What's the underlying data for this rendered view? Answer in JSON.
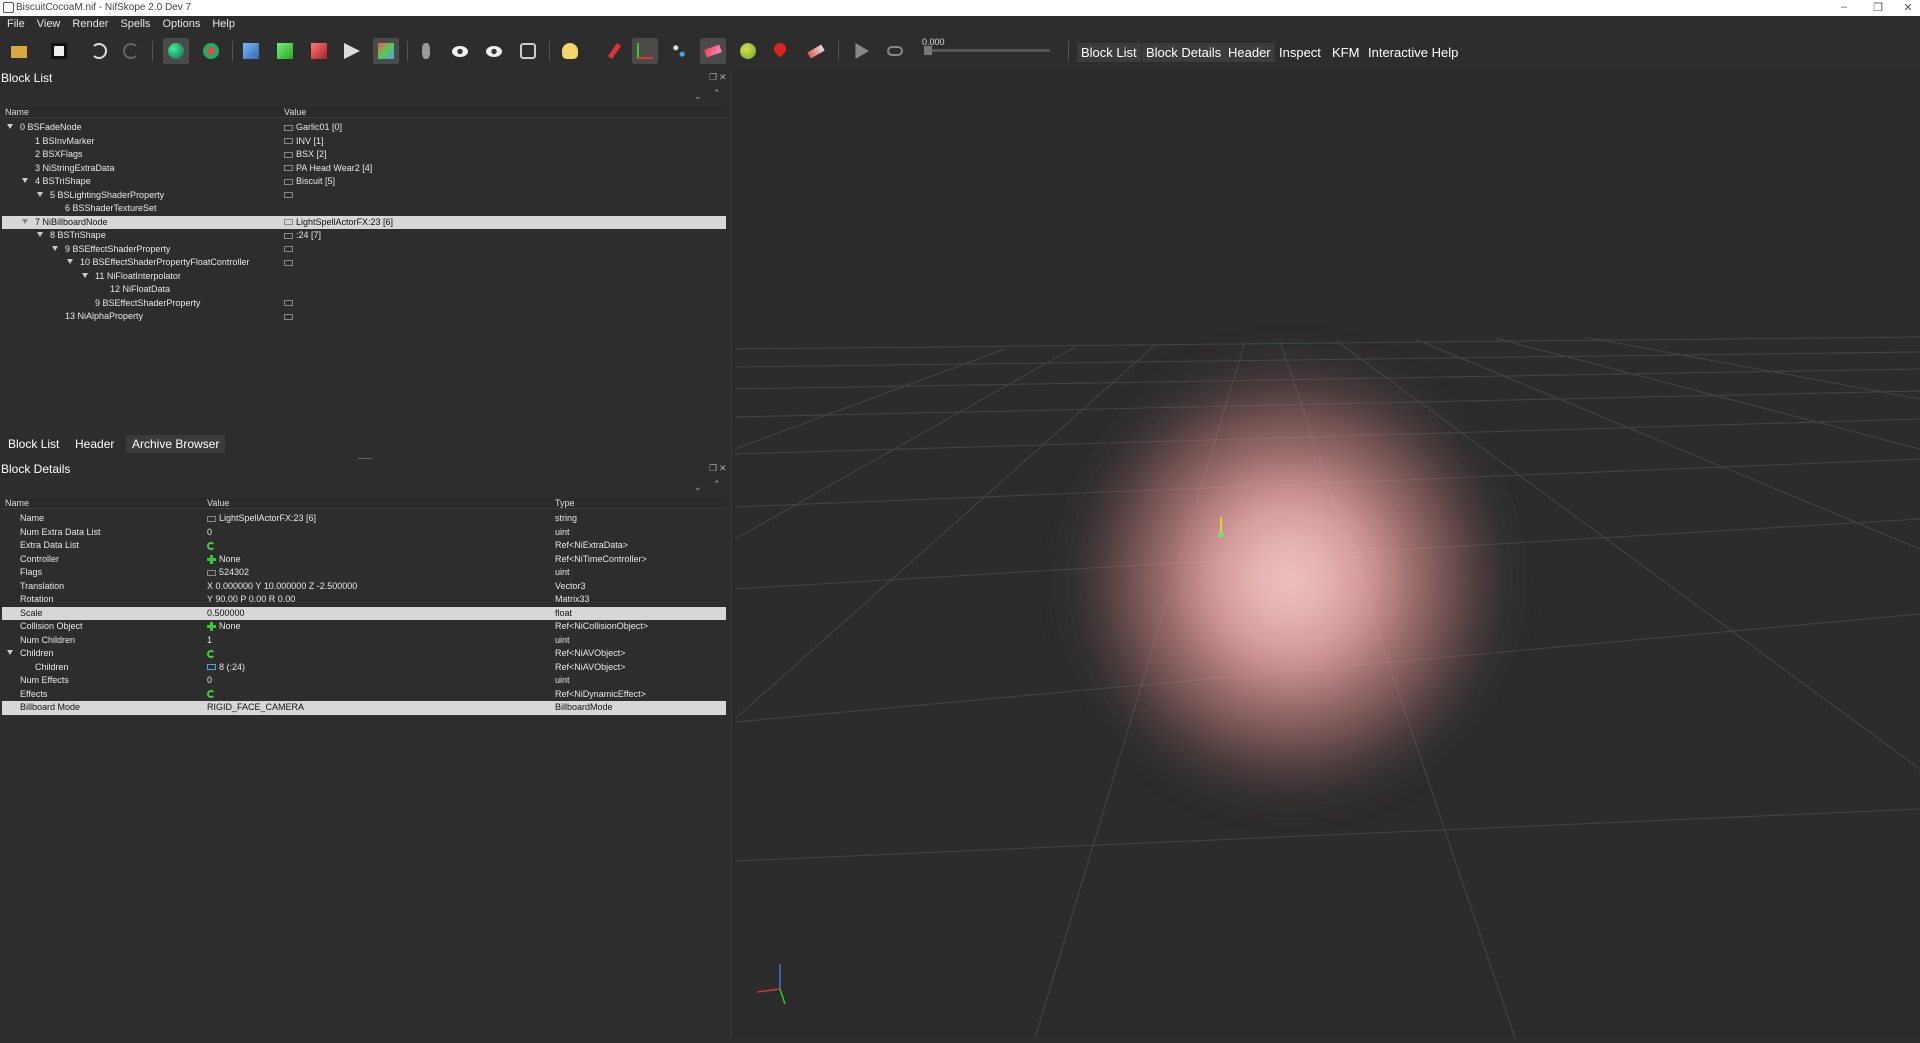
{
  "window": {
    "title": "BiscuitCocoaM.nif - NifSkope 2.0 Dev 7",
    "controls": [
      "–",
      "❐",
      "✕"
    ]
  },
  "menu": [
    "File",
    "View",
    "Render",
    "Spells",
    "Options",
    "Help"
  ],
  "toolbar": {
    "icons": [
      "load-icon",
      "save-icon",
      "undo-icon",
      "redo-icon",
      "select-icon",
      "transform-icon",
      "view-front-icon",
      "view-top-icon",
      "view-side-icon",
      "view-user-icon",
      "view-walk-icon",
      "footprints-icon",
      "eye-icon",
      "eye-show-icon",
      "screenshot-icon",
      "light-icon",
      "pin-icon",
      "axes-icon",
      "nodes-icon",
      "wand-icon",
      "sphere-icon",
      "marker-icon",
      "brush-icon",
      "play-icon",
      "loop-icon"
    ],
    "time_value": "0.000",
    "tabs": [
      "Block List",
      "Block Details",
      "Header",
      "Inspect",
      "KFM",
      "Interactive Help"
    ]
  },
  "block_list": {
    "title": "Block List",
    "columns": [
      "Name",
      "Value"
    ],
    "rows": [
      {
        "name": "0 BSFadeNode",
        "value": "Garlic01 [0]"
      },
      {
        "name": "1 BSInvMarker",
        "value": "INV [1]"
      },
      {
        "name": "2 BSXFlags",
        "value": "BSX [2]"
      },
      {
        "name": "3 NiStringExtraData",
        "value": "PA Head Wear2 [4]"
      },
      {
        "name": "4 BSTriShape",
        "value": "Biscuit [5]"
      },
      {
        "name": "5 BSLightingShaderProperty",
        "value": ""
      },
      {
        "name": "6 BSShaderTextureSet",
        "value": ""
      },
      {
        "name": "7 NiBillboardNode",
        "value": "LightSpellActorFX:23 [6]"
      },
      {
        "name": "8 BSTriShape",
        "value": ":24 [7]"
      },
      {
        "name": "9 BSEffectShaderProperty",
        "value": ""
      },
      {
        "name": "10 BSEffectShaderPropertyFloatController",
        "value": ""
      },
      {
        "name": "11 NiFloatInterpolator",
        "value": ""
      },
      {
        "name": "12 NiFloatData",
        "value": ""
      },
      {
        "name": "9 BSEffectShaderProperty",
        "value": ""
      },
      {
        "name": "13 NiAlphaProperty",
        "value": ""
      }
    ],
    "bottom_tabs": [
      "Block List",
      "Header",
      "Archive Browser"
    ]
  },
  "block_details": {
    "title": "Block Details",
    "columns": [
      "Name",
      "Value",
      "Type"
    ],
    "rows": [
      {
        "name": "Name",
        "value": "LightSpellActorFX:23 [6]",
        "type": "string"
      },
      {
        "name": "Num Extra Data List",
        "value": "0",
        "type": "uint"
      },
      {
        "name": "Extra Data List",
        "value": "",
        "type": "Ref<NiExtraData>"
      },
      {
        "name": "Controller",
        "value": "None",
        "type": "Ref<NiTimeController>"
      },
      {
        "name": "Flags",
        "value": "524302",
        "type": "uint"
      },
      {
        "name": "Translation",
        "value": "X 0.000000 Y 10.000000 Z -2.500000",
        "type": "Vector3"
      },
      {
        "name": "Rotation",
        "value": "Y 90.00 P 0.00 R 0.00",
        "type": "Matrix33"
      },
      {
        "name": "Scale",
        "value": "0.500000",
        "type": "float"
      },
      {
        "name": "Collision Object",
        "value": "None",
        "type": "Ref<NiCollisionObject>"
      },
      {
        "name": "Num Children",
        "value": "1",
        "type": "uint"
      },
      {
        "name": "Children",
        "value": "",
        "type": "Ref<NiAVObject>"
      },
      {
        "name": "Children",
        "value": "8 (:24)",
        "type": "Ref<NiAVObject>"
      },
      {
        "name": "Num Effects",
        "value": "0",
        "type": "uint"
      },
      {
        "name": "Effects",
        "value": "",
        "type": "Ref<NiDynamicEffect>"
      },
      {
        "name": "Billboard Mode",
        "value": "RIGID_FACE_CAMERA",
        "type": "BillboardMode"
      }
    ]
  },
  "colors": {
    "background": "#2d2d2d",
    "selection": "#d7d7d7",
    "glow": "#ffb4b4",
    "grid": "#4a4a4a"
  }
}
